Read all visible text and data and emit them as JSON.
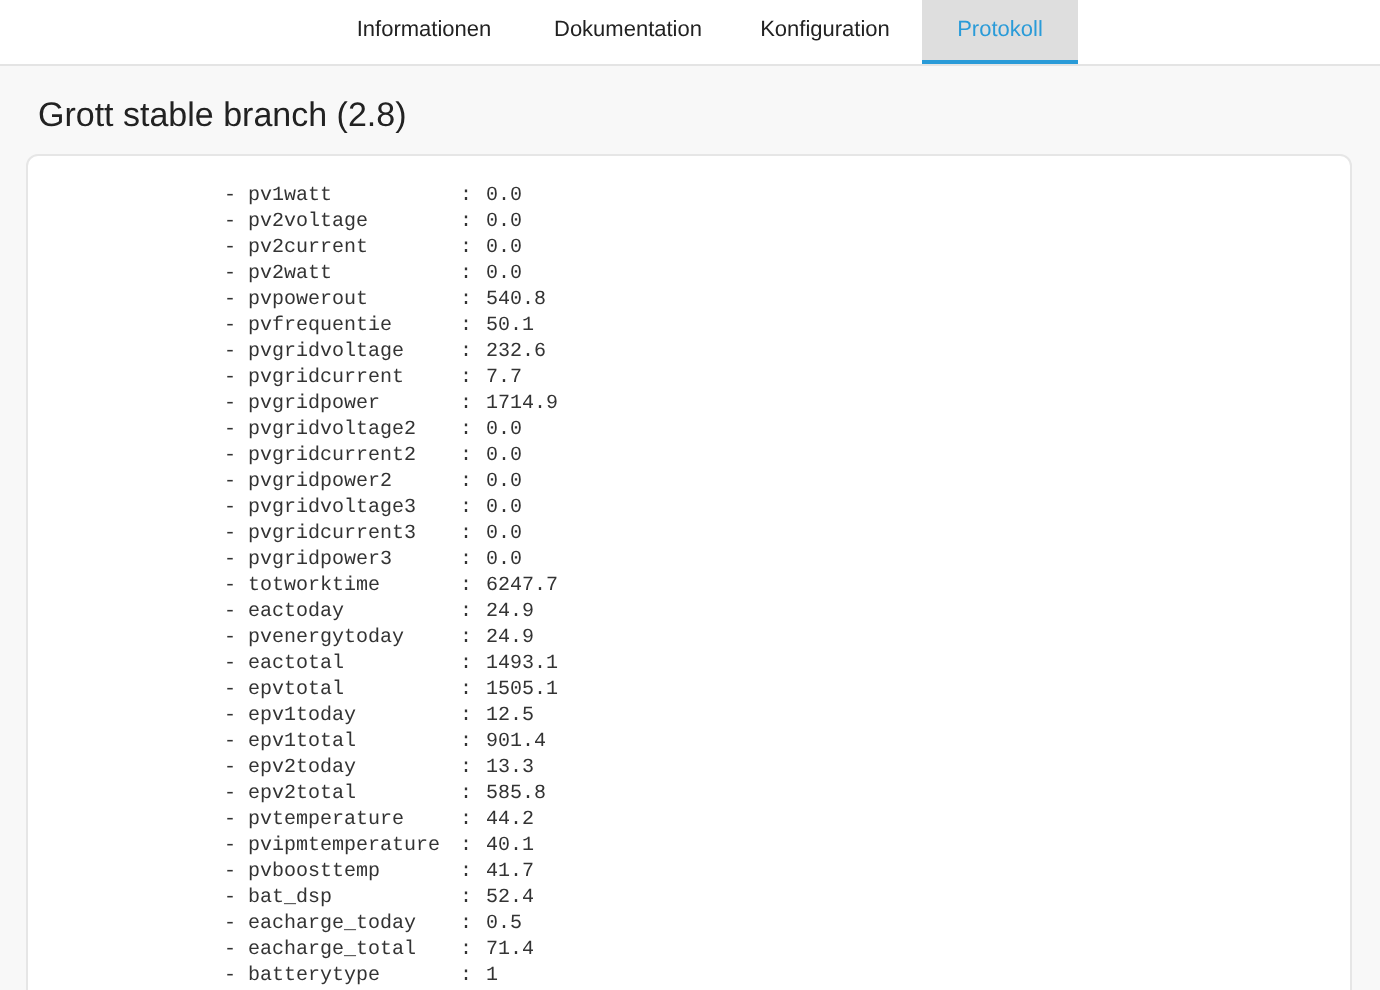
{
  "tabs": [
    {
      "label": "Informationen",
      "selected": false
    },
    {
      "label": "Dokumentation",
      "selected": false
    },
    {
      "label": "Konfiguration",
      "selected": false
    },
    {
      "label": "Protokoll",
      "selected": true
    }
  ],
  "title": "Grott stable branch (2.8)",
  "log_rows": [
    {
      "bullet": "-",
      "key": "pv1watt",
      "separator": ":",
      "value": "0.0"
    },
    {
      "bullet": "-",
      "key": "pv2voltage",
      "separator": ":",
      "value": "0.0"
    },
    {
      "bullet": "-",
      "key": "pv2current",
      "separator": ":",
      "value": "0.0"
    },
    {
      "bullet": "-",
      "key": "pv2watt",
      "separator": ":",
      "value": "0.0"
    },
    {
      "bullet": "-",
      "key": "pvpowerout",
      "separator": ":",
      "value": "540.8"
    },
    {
      "bullet": "-",
      "key": "pvfrequentie",
      "separator": ":",
      "value": "50.1"
    },
    {
      "bullet": "-",
      "key": "pvgridvoltage",
      "separator": ":",
      "value": "232.6"
    },
    {
      "bullet": "-",
      "key": "pvgridcurrent",
      "separator": ":",
      "value": "7.7"
    },
    {
      "bullet": "-",
      "key": "pvgridpower",
      "separator": ":",
      "value": "1714.9"
    },
    {
      "bullet": "-",
      "key": "pvgridvoltage2",
      "separator": ":",
      "value": "0.0"
    },
    {
      "bullet": "-",
      "key": "pvgridcurrent2",
      "separator": ":",
      "value": "0.0"
    },
    {
      "bullet": "-",
      "key": "pvgridpower2",
      "separator": ":",
      "value": "0.0"
    },
    {
      "bullet": "-",
      "key": "pvgridvoltage3",
      "separator": ":",
      "value": "0.0"
    },
    {
      "bullet": "-",
      "key": "pvgridcurrent3",
      "separator": ":",
      "value": "0.0"
    },
    {
      "bullet": "-",
      "key": "pvgridpower3",
      "separator": ":",
      "value": "0.0"
    },
    {
      "bullet": "-",
      "key": "totworktime",
      "separator": ":",
      "value": "6247.7"
    },
    {
      "bullet": "-",
      "key": "eactoday",
      "separator": ":",
      "value": "24.9"
    },
    {
      "bullet": "-",
      "key": "pvenergytoday",
      "separator": ":",
      "value": "24.9"
    },
    {
      "bullet": "-",
      "key": "eactotal",
      "separator": ":",
      "value": "1493.1"
    },
    {
      "bullet": "-",
      "key": "epvtotal",
      "separator": ":",
      "value": "1505.1"
    },
    {
      "bullet": "-",
      "key": "epv1today",
      "separator": ":",
      "value": "12.5"
    },
    {
      "bullet": "-",
      "key": "epv1total",
      "separator": ":",
      "value": "901.4"
    },
    {
      "bullet": "-",
      "key": "epv2today",
      "separator": ":",
      "value": "13.3"
    },
    {
      "bullet": "-",
      "key": "epv2total",
      "separator": ":",
      "value": "585.8"
    },
    {
      "bullet": "-",
      "key": "pvtemperature",
      "separator": ":",
      "value": "44.2"
    },
    {
      "bullet": "-",
      "key": "pvipmtemperature",
      "separator": ":",
      "value": "40.1"
    },
    {
      "bullet": "-",
      "key": "pvboosttemp",
      "separator": ":",
      "value": "41.7"
    },
    {
      "bullet": "-",
      "key": "bat_dsp",
      "separator": ":",
      "value": "52.4"
    },
    {
      "bullet": "-",
      "key": "eacharge_today",
      "separator": ":",
      "value": "0.5"
    },
    {
      "bullet": "-",
      "key": "eacharge_total",
      "separator": ":",
      "value": "71.4"
    },
    {
      "bullet": "-",
      "key": "batterytype",
      "separator": ":",
      "value": "1"
    }
  ]
}
